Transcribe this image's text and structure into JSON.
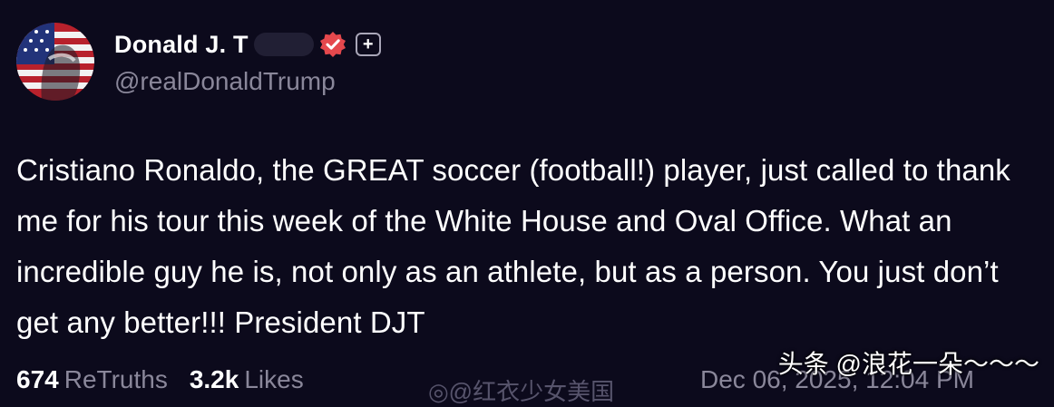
{
  "post": {
    "author": {
      "display_name": "Donald J. T",
      "handle": "@realDonaldTrump",
      "avatar_icon": "flag-portrait-avatar",
      "verified_icon": "verified-badge-icon",
      "verified_color": "#e5484d",
      "plus_label": "+"
    },
    "body": "Cristiano Ronaldo, the GREAT soccer (football!) player, just called to thank me for his tour this week of the White House and Oval Office. What an incredible guy he is, not only as an athlete, but as a person. You just don’t get any better!!! President DJT",
    "stats": {
      "retruths_count": "674",
      "retruths_label": "ReTruths",
      "likes_count": "3.2k",
      "likes_label": "Likes"
    },
    "timestamp": "Dec 06, 2025, 12:04 PM"
  },
  "watermarks": {
    "main": "头条 @浪花一朵～～～",
    "faint": "◎@红衣少女美国"
  },
  "colors": {
    "background": "#0c0a1c",
    "text": "#ffffff",
    "muted": "#8a879a",
    "badge": "#e5484d"
  }
}
